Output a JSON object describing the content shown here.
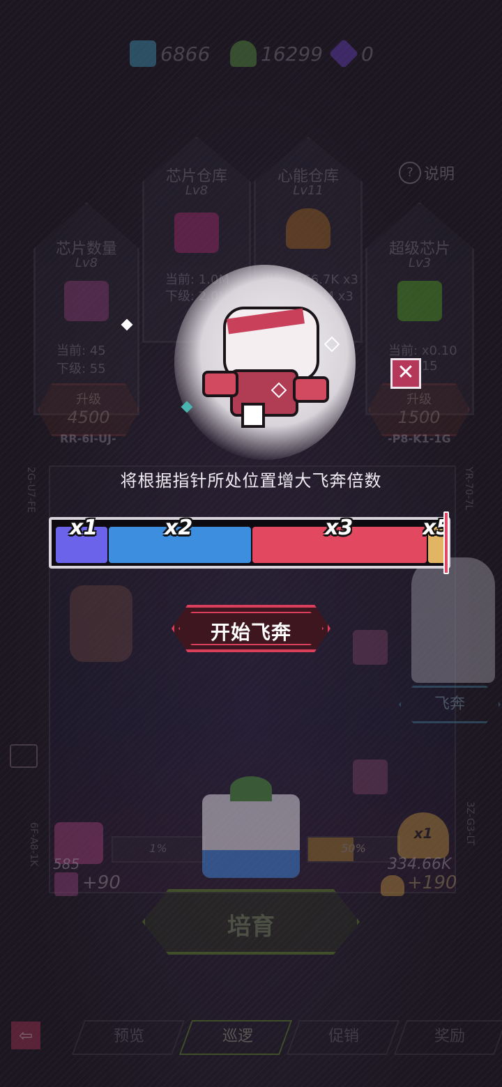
{
  "currency": {
    "chips": "6866",
    "sprouts": "16299",
    "gems": "0"
  },
  "help_label": "说明",
  "buildings": [
    {
      "title": "芯片数量",
      "level": "Lv8",
      "current": "当前: 45",
      "next": "下级: 55",
      "upgrade_label": "升级",
      "cost": "4500",
      "code": "RR-6I-UJ-"
    },
    {
      "title": "芯片仓库",
      "level": "Lv8",
      "current": "当前: 1.0M",
      "next": "下级: 2.0M"
    },
    {
      "title": "心能仓库",
      "level": "Lv11",
      "current": "当前: 666.7K x3",
      "next": "下级: 1.0M x3"
    },
    {
      "title": "超级芯片",
      "level": "Lv3",
      "current": "当前: x0.10",
      "next": "x0.15",
      "upgrade_label": "升级",
      "cost": "1500",
      "code": "-P8-K1-1G"
    }
  ],
  "modal": {
    "instruction": "将根据指针所处位置增大飞奔倍数",
    "multipliers": [
      {
        "label": "x1",
        "color": "#6b63ea"
      },
      {
        "label": "x2",
        "color": "#3e8ee0"
      },
      {
        "label": "x3",
        "color": "#e24860"
      },
      {
        "label": "x5",
        "color": "#e2b565"
      }
    ],
    "pointer_value": "x5",
    "start_label": "开始飞奔",
    "close_label": "✕"
  },
  "side": {
    "left_codes": "2G-U7-FE",
    "right_codes": "YR-70-7L",
    "run_label": "飞奔"
  },
  "bottom": {
    "left_count": "585",
    "left_bonus": "+90",
    "left_percent": "1%",
    "right_percent": "50%",
    "right_multiplier": "x1",
    "right_count": "334.66K",
    "right_bonus": "+190",
    "cultivate_label": "培育",
    "codes_left": "6F-A8-1K",
    "codes_right": "3Z-G3-LT"
  },
  "nav": {
    "back_icon": "back-arrow-icon",
    "tabs": [
      "预览",
      "巡逻",
      "促销",
      "奖励"
    ],
    "active_tab": "巡逻"
  }
}
